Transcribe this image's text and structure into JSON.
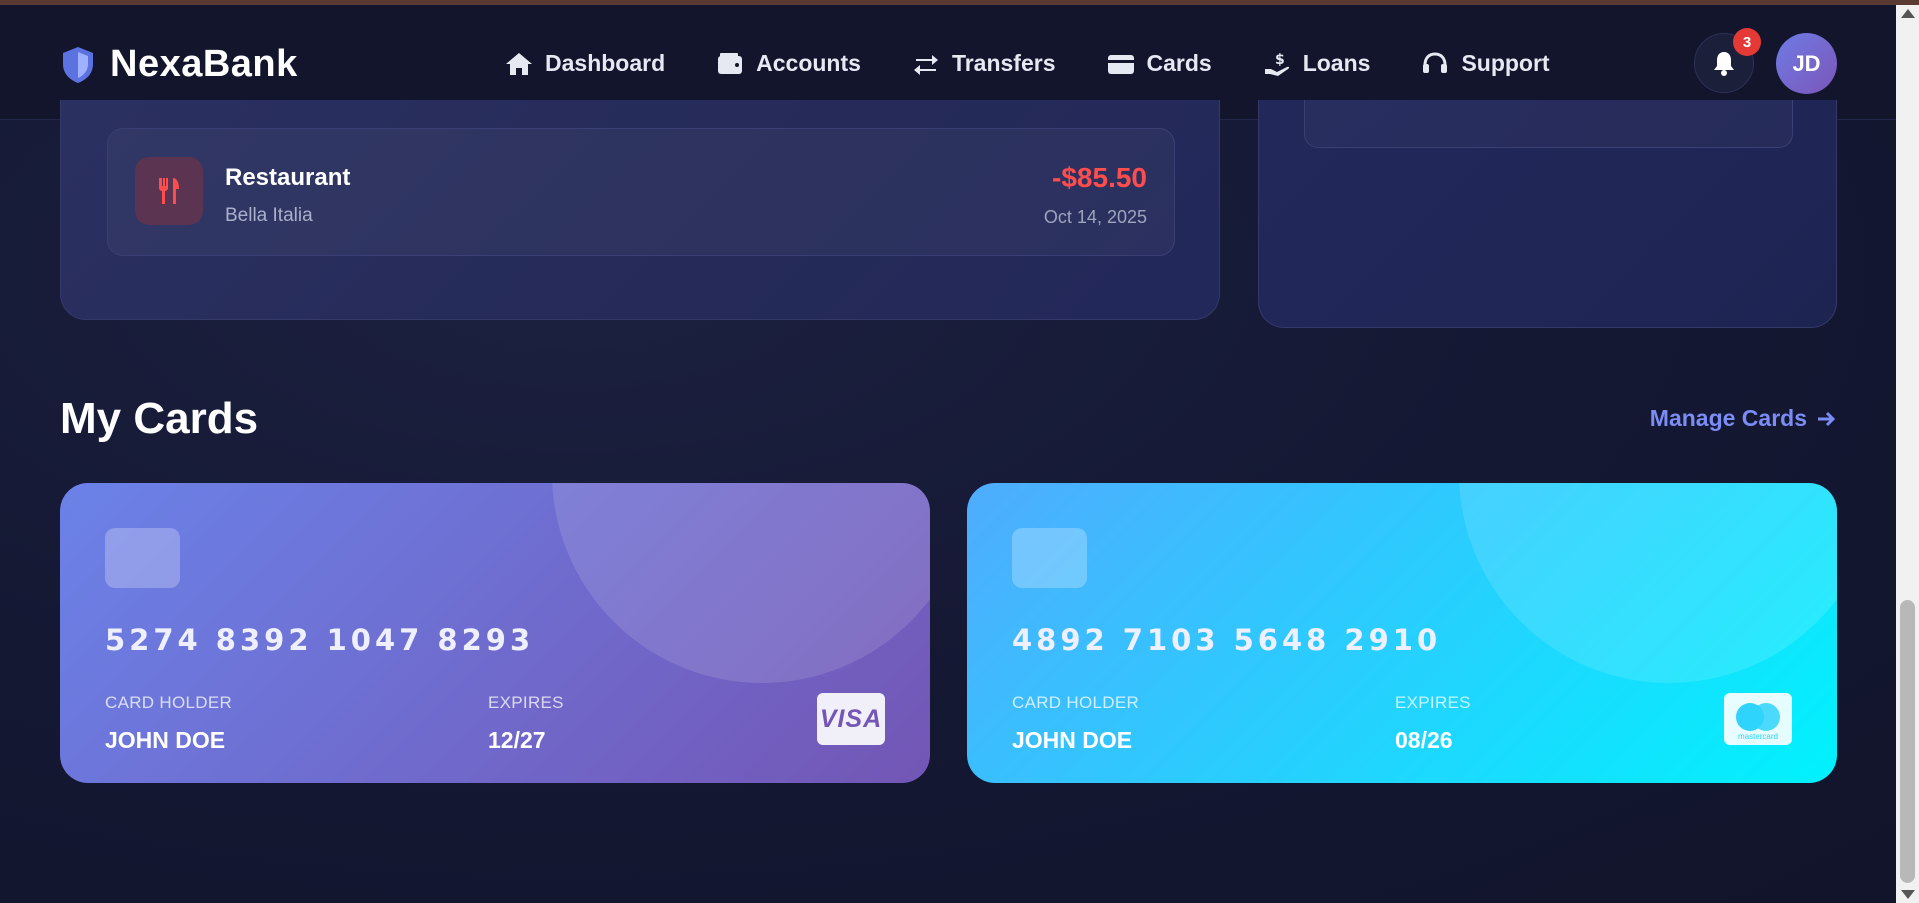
{
  "app": {
    "name": "NexaBank"
  },
  "nav": {
    "items": [
      {
        "label": "Dashboard",
        "icon": "home-icon"
      },
      {
        "label": "Accounts",
        "icon": "wallet-icon"
      },
      {
        "label": "Transfers",
        "icon": "exchange-icon"
      },
      {
        "label": "Cards",
        "icon": "credit-card-icon"
      },
      {
        "label": "Loans",
        "icon": "hand-dollar-icon"
      },
      {
        "label": "Support",
        "icon": "headset-icon"
      }
    ],
    "notifications_count": "3",
    "avatar_initials": "JD"
  },
  "transaction": {
    "title": "Restaurant",
    "merchant": "Bella Italia",
    "amount": "-$85.50",
    "date": "Oct 14, 2025",
    "icon": "utensils-icon",
    "amount_color": "#ff4d4d"
  },
  "cards_section": {
    "title": "My Cards",
    "manage_label": "Manage Cards",
    "cards": [
      {
        "number": "5274 8392 1047 8293",
        "holder_label": "CARD HOLDER",
        "holder": "JOHN DOE",
        "expires_label": "EXPIRES",
        "expires": "12/27",
        "brand": "VISA",
        "gradient": [
          "#6b82e8",
          "#7356b5"
        ]
      },
      {
        "number": "4892 7103 5648 2910",
        "holder_label": "CARD HOLDER",
        "holder": "JOHN DOE",
        "expires_label": "EXPIRES",
        "expires": "08/26",
        "brand": "mastercard",
        "gradient": [
          "#4facfe",
          "#00f2fe"
        ]
      }
    ]
  },
  "colors": {
    "accent": "#7b8cf5",
    "background": "#141833",
    "negative": "#ff4d4d"
  }
}
